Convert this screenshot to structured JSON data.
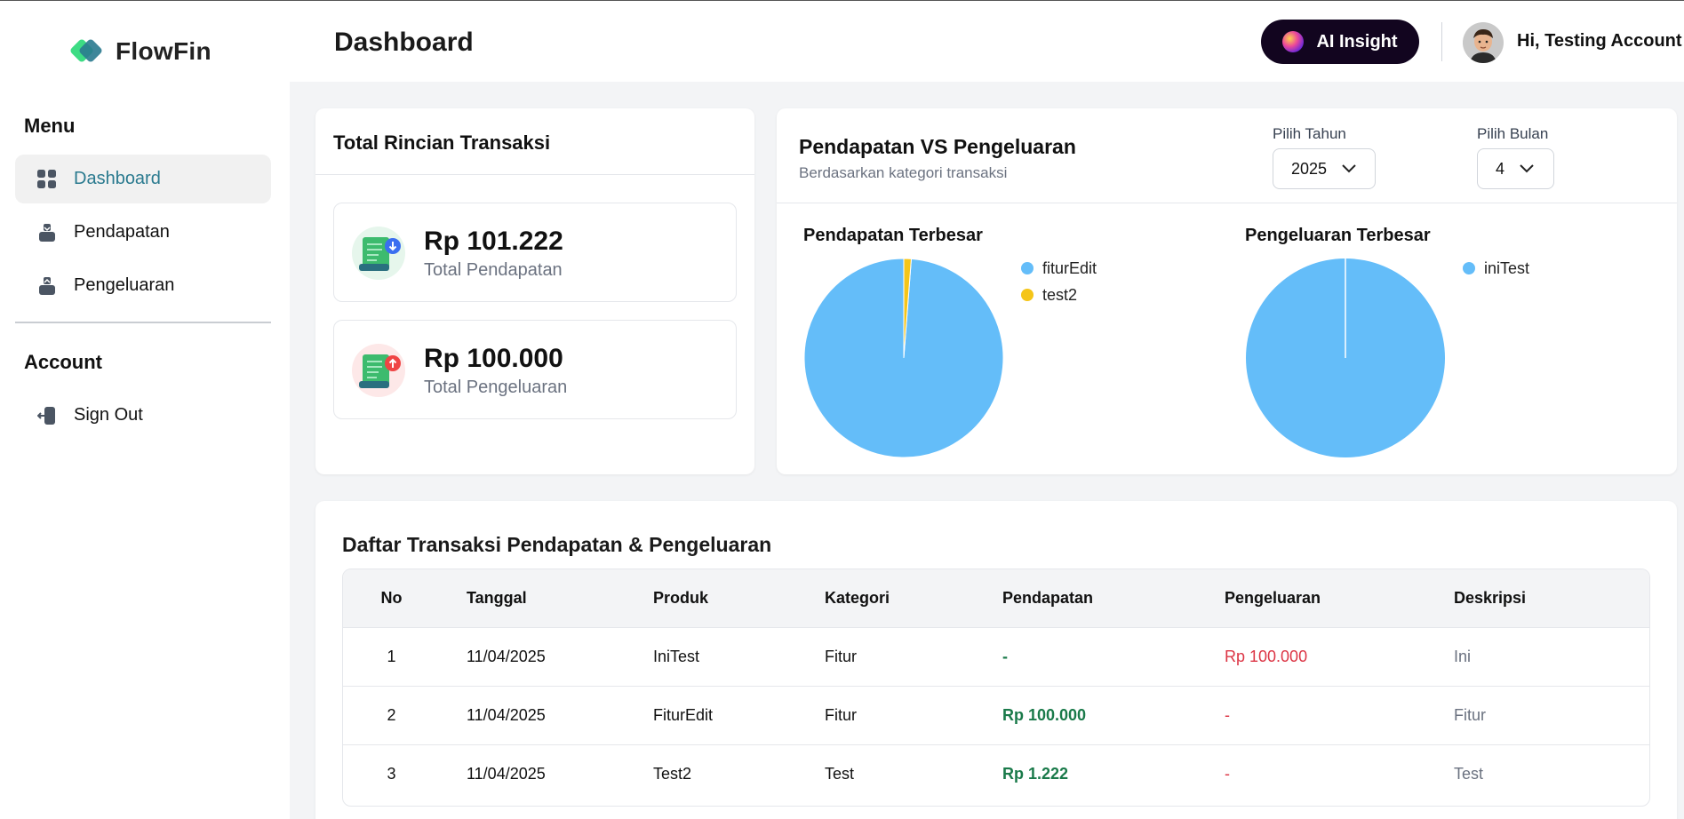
{
  "brand": {
    "name": "FlowFin"
  },
  "sidebar": {
    "menu_heading": "Menu",
    "items": [
      {
        "label": "Dashboard",
        "icon": "dashboard-grid-icon"
      },
      {
        "label": "Pendapatan",
        "icon": "income-tray-icon"
      },
      {
        "label": "Pengeluaran",
        "icon": "expense-tray-icon"
      }
    ],
    "account_heading": "Account",
    "account_items": [
      {
        "label": "Sign Out",
        "icon": "sign-out-icon"
      }
    ]
  },
  "header": {
    "title": "Dashboard",
    "ai_button": "AI Insight",
    "greeting": "Hi, Testing Account"
  },
  "summary": {
    "title": "Total Rincian Transaksi",
    "income": {
      "amount": "Rp 101.222",
      "label": "Total Pendapatan"
    },
    "expense": {
      "amount": "Rp 100.000",
      "label": "Total Pengeluaran"
    }
  },
  "charts_panel": {
    "title": "Pendapatan VS Pengeluaran",
    "subtitle": "Berdasarkan kategori transaksi",
    "year_label": "Pilih Tahun",
    "year_value": "2025",
    "month_label": "Pilih Bulan",
    "month_value": "4"
  },
  "chart_data": [
    {
      "type": "pie",
      "title": "Pendapatan Terbesar",
      "categories": [
        "fiturEdit",
        "test2"
      ],
      "values": [
        100000,
        1222
      ],
      "colors": [
        "#64bdf9",
        "#f5c518"
      ]
    },
    {
      "type": "pie",
      "title": "Pengeluaran Terbesar",
      "categories": [
        "iniTest"
      ],
      "values": [
        100000
      ],
      "colors": [
        "#64bdf9"
      ]
    }
  ],
  "table": {
    "title": "Daftar Transaksi Pendapatan & Pengeluaran",
    "columns": [
      "No",
      "Tanggal",
      "Produk",
      "Kategori",
      "Pendapatan",
      "Pengeluaran",
      "Deskripsi"
    ],
    "rows": [
      [
        "1",
        "11/04/2025",
        "IniTest",
        "Fitur",
        "-",
        "Rp 100.000",
        "Ini"
      ],
      [
        "2",
        "11/04/2025",
        "FiturEdit",
        "Fitur",
        "Rp 100.000",
        "-",
        "Fitur"
      ],
      [
        "3",
        "11/04/2025",
        "Test2",
        "Test",
        "Rp 1.222",
        "-",
        "Test"
      ]
    ]
  },
  "colors": {
    "accent": "#2a7a8f",
    "income": "#1a7a4a",
    "expense": "#dc3545",
    "ai_button": "#12051f"
  }
}
